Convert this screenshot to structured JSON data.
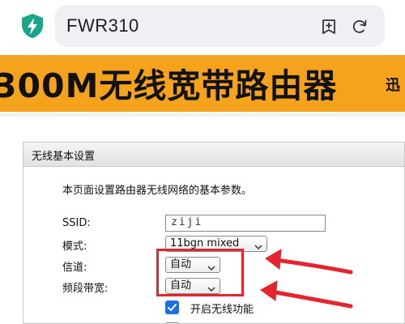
{
  "browser": {
    "url_text": "FWR310",
    "icons": [
      "shield-lightning-icon",
      "add-bookmark-icon",
      "refresh-icon"
    ]
  },
  "banner": {
    "title": "300M无线宽带路由器",
    "subtitle": "迅"
  },
  "panel": {
    "title": "无线基本设置",
    "description": "本页面设置路由器无线网络的基本参数。",
    "ssid_label": "SSID:",
    "ssid_value": "ziji",
    "mode_label": "模式:",
    "mode_value": "11bgn mixed",
    "channel_label": "信道:",
    "channel_value": "自动",
    "bandwidth_label": "频段带宽:",
    "bandwidth_value": "自动",
    "wireless_enable_label": "开启无线功能",
    "wireless_enable_checked": true
  },
  "colors": {
    "banner_orange": "#f5a31c",
    "shield_teal": "#1aa58c",
    "highlight_red": "#e4242e",
    "checkbox_blue": "#1b6fe0"
  }
}
